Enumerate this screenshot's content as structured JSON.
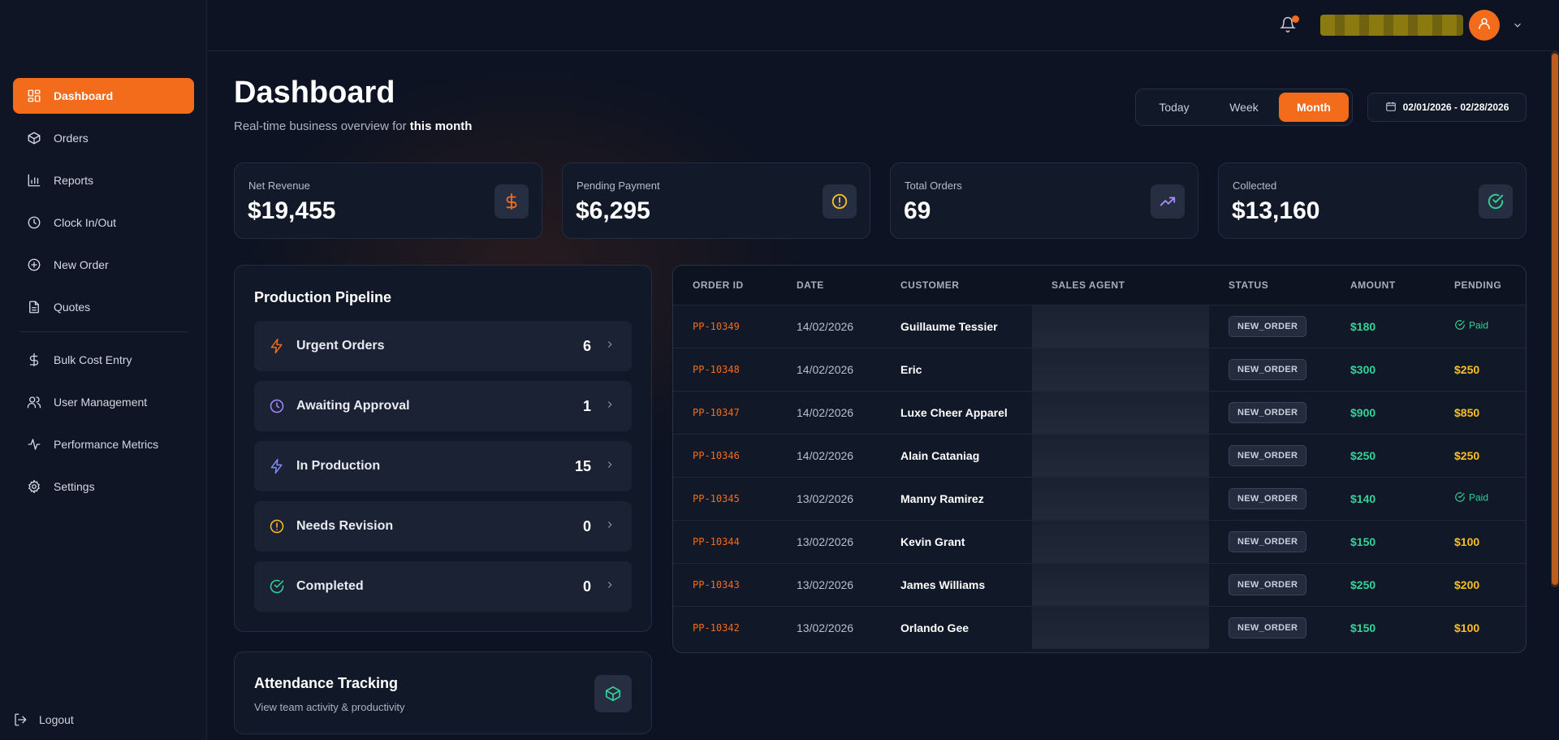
{
  "sidebar": {
    "items": [
      {
        "label": "Dashboard",
        "icon": "dashboard-icon",
        "active": true
      },
      {
        "label": "Orders",
        "icon": "box-icon"
      },
      {
        "label": "Reports",
        "icon": "bar-chart-icon"
      },
      {
        "label": "Clock In/Out",
        "icon": "clock-icon"
      },
      {
        "label": "New Order",
        "icon": "plus-circle-icon"
      },
      {
        "label": "Quotes",
        "icon": "document-icon"
      },
      {
        "label": "Bulk Cost Entry",
        "icon": "dollar-icon"
      },
      {
        "label": "User Management",
        "icon": "users-icon"
      },
      {
        "label": "Performance Metrics",
        "icon": "activity-icon"
      },
      {
        "label": "Settings",
        "icon": "gear-icon"
      }
    ],
    "logout_label": "Logout"
  },
  "header": {
    "title": "Dashboard",
    "subtitle_prefix": "Real-time business overview for",
    "subtitle_highlight": "this month",
    "ranges": [
      "Today",
      "Week",
      "Month"
    ],
    "active_range": "Month",
    "date_range": "02/01/2026 - 02/28/2026"
  },
  "stats": [
    {
      "label": "Net Revenue",
      "value": "$19,455",
      "icon": "dollar-icon",
      "color": "#f36c1c"
    },
    {
      "label": "Pending Payment",
      "value": "$6,295",
      "icon": "alert-circle-icon",
      "color": "#fbbf24"
    },
    {
      "label": "Total Orders",
      "value": "69",
      "icon": "trending-up-icon",
      "color": "#a78bfa"
    },
    {
      "label": "Collected",
      "value": "$13,160",
      "icon": "check-circle-icon",
      "color": "#34d399"
    }
  ],
  "pipeline": {
    "title": "Production Pipeline",
    "items": [
      {
        "label": "Urgent Orders",
        "count": "6",
        "icon": "bolt-icon",
        "color": "#f36c1c"
      },
      {
        "label": "Awaiting Approval",
        "count": "1",
        "icon": "clock-icon",
        "color": "#a78bfa"
      },
      {
        "label": "In Production",
        "count": "15",
        "icon": "bolt-icon",
        "color": "#818cf8"
      },
      {
        "label": "Needs Revision",
        "count": "0",
        "icon": "alert-circle-icon",
        "color": "#fbbf24"
      },
      {
        "label": "Completed",
        "count": "0",
        "icon": "check-circle-icon",
        "color": "#34d399"
      }
    ]
  },
  "attendance": {
    "title": "Attendance Tracking",
    "subtitle": "View team activity & productivity",
    "icon": "cube-icon"
  },
  "orders_table": {
    "headers": [
      "ORDER ID",
      "DATE",
      "CUSTOMER",
      "SALES AGENT",
      "STATUS",
      "AMOUNT",
      "PENDING"
    ],
    "rows": [
      {
        "id": "PP-10349",
        "date": "14/02/2026",
        "customer": "Guillaume Tessier",
        "agent": "",
        "status": "NEW_ORDER",
        "amount": "$180",
        "pending": "Paid",
        "paid": true
      },
      {
        "id": "PP-10348",
        "date": "14/02/2026",
        "customer": "Eric",
        "agent": "",
        "status": "NEW_ORDER",
        "amount": "$300",
        "pending": "$250",
        "paid": false
      },
      {
        "id": "PP-10347",
        "date": "14/02/2026",
        "customer": "Luxe Cheer Apparel",
        "agent": "",
        "status": "NEW_ORDER",
        "amount": "$900",
        "pending": "$850",
        "paid": false
      },
      {
        "id": "PP-10346",
        "date": "14/02/2026",
        "customer": "Alain Cataniag",
        "agent": "",
        "status": "NEW_ORDER",
        "amount": "$250",
        "pending": "$250",
        "paid": false
      },
      {
        "id": "PP-10345",
        "date": "13/02/2026",
        "customer": "Manny Ramirez",
        "agent": "",
        "status": "NEW_ORDER",
        "amount": "$140",
        "pending": "Paid",
        "paid": true
      },
      {
        "id": "PP-10344",
        "date": "13/02/2026",
        "customer": "Kevin Grant",
        "agent": "",
        "status": "NEW_ORDER",
        "amount": "$150",
        "pending": "$100",
        "paid": false
      },
      {
        "id": "PP-10343",
        "date": "13/02/2026",
        "customer": "James Williams",
        "agent": "",
        "status": "NEW_ORDER",
        "amount": "$250",
        "pending": "$200",
        "paid": false
      },
      {
        "id": "PP-10342",
        "date": "13/02/2026",
        "customer": "Orlando Gee",
        "agent": "",
        "status": "NEW_ORDER",
        "amount": "$150",
        "pending": "$100",
        "paid": false
      }
    ]
  },
  "colors": {
    "accent": "#f36c1c",
    "success": "#34d399",
    "warning": "#fbbf24",
    "background": "#0d1322"
  }
}
